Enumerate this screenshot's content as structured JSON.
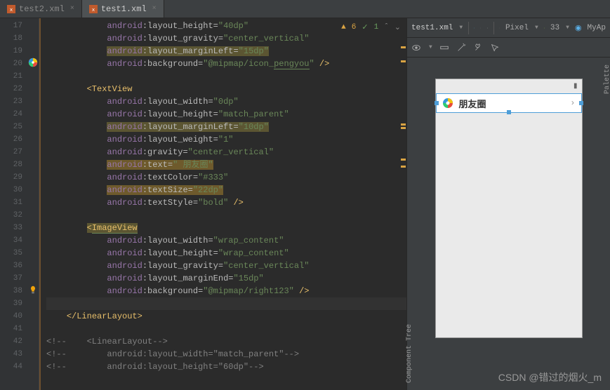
{
  "tabs": [
    {
      "name": "test2.xml",
      "active": false
    },
    {
      "name": "test1.xml",
      "active": true
    }
  ],
  "gutter": {
    "start": 17,
    "end": 44
  },
  "errors": {
    "warnings": "6",
    "oks": "1"
  },
  "code_lines": [
    {
      "n": 17,
      "indent": 3,
      "tokens": [
        [
          "ns",
          "android"
        ],
        [
          "attr",
          ":layout_height="
        ],
        [
          "val",
          "\"40dp\""
        ]
      ]
    },
    {
      "n": 18,
      "indent": 3,
      "tokens": [
        [
          "ns",
          "android"
        ],
        [
          "attr",
          ":layout_gravity="
        ],
        [
          "val",
          "\"center_vertical\""
        ]
      ]
    },
    {
      "n": 19,
      "indent": 3,
      "hl": true,
      "tokens": [
        [
          "ns",
          "android"
        ],
        [
          "attr",
          ":layout_marginLeft="
        ],
        [
          "val",
          "\"15dp\""
        ]
      ]
    },
    {
      "n": 20,
      "indent": 3,
      "img": true,
      "tokens": [
        [
          "ns",
          "android"
        ],
        [
          "attr",
          ":background="
        ],
        [
          "val",
          "\"@mipmap/icon_"
        ],
        [
          "valU",
          "pengyou"
        ],
        [
          "val",
          "\""
        ],
        [
          "br",
          " />"
        ]
      ]
    },
    {
      "n": 21,
      "indent": 0,
      "tokens": []
    },
    {
      "n": 22,
      "indent": 2,
      "tokens": [
        [
          "tag",
          "<TextView"
        ]
      ]
    },
    {
      "n": 23,
      "indent": 3,
      "tokens": [
        [
          "ns",
          "android"
        ],
        [
          "attr",
          ":layout_width="
        ],
        [
          "val",
          "\"0dp\""
        ]
      ]
    },
    {
      "n": 24,
      "indent": 3,
      "tokens": [
        [
          "ns",
          "android"
        ],
        [
          "attr",
          ":layout_height="
        ],
        [
          "val",
          "\"match_parent\""
        ]
      ]
    },
    {
      "n": 25,
      "indent": 3,
      "hl": true,
      "tokens": [
        [
          "ns",
          "android"
        ],
        [
          "attr",
          ":layout_marginLeft="
        ],
        [
          "val",
          "\"10dp\""
        ]
      ]
    },
    {
      "n": 26,
      "indent": 3,
      "tokens": [
        [
          "ns",
          "android"
        ],
        [
          "attr",
          ":layout_weight="
        ],
        [
          "val",
          "\"1\""
        ]
      ]
    },
    {
      "n": 27,
      "indent": 3,
      "tokens": [
        [
          "ns",
          "android"
        ],
        [
          "attr",
          ":gravity="
        ],
        [
          "val",
          "\"center_vertical\""
        ]
      ]
    },
    {
      "n": 28,
      "indent": 3,
      "hl2": true,
      "tokens": [
        [
          "ns",
          "android"
        ],
        [
          "attr",
          ":text="
        ],
        [
          "val",
          "\" 朋友圈\""
        ]
      ]
    },
    {
      "n": 29,
      "indent": 3,
      "tokens": [
        [
          "ns",
          "android"
        ],
        [
          "attr",
          ":textColor="
        ],
        [
          "val",
          "\"#333\""
        ]
      ]
    },
    {
      "n": 30,
      "indent": 3,
      "hl2": true,
      "tokens": [
        [
          "ns",
          "android"
        ],
        [
          "attr",
          ":textSize="
        ],
        [
          "val",
          "\"22dp\""
        ]
      ]
    },
    {
      "n": 31,
      "indent": 3,
      "tokens": [
        [
          "ns",
          "android"
        ],
        [
          "attr",
          ":textStyle="
        ],
        [
          "val",
          "\"bold\""
        ],
        [
          "br",
          " />"
        ]
      ]
    },
    {
      "n": 32,
      "indent": 0,
      "tokens": []
    },
    {
      "n": 33,
      "indent": 2,
      "hl": true,
      "tokens": [
        [
          "tag",
          "<"
        ],
        [
          "tagU",
          "ImageView"
        ]
      ]
    },
    {
      "n": 34,
      "indent": 3,
      "tokens": [
        [
          "ns",
          "android"
        ],
        [
          "attr",
          ":layout_width="
        ],
        [
          "val",
          "\"wrap_content\""
        ]
      ]
    },
    {
      "n": 35,
      "indent": 3,
      "tokens": [
        [
          "ns",
          "android"
        ],
        [
          "attr",
          ":layout_height="
        ],
        [
          "val",
          "\"wrap_content\""
        ]
      ]
    },
    {
      "n": 36,
      "indent": 3,
      "tokens": [
        [
          "ns",
          "android"
        ],
        [
          "attr",
          ":layout_gravity="
        ],
        [
          "val",
          "\"center_vertical\""
        ]
      ]
    },
    {
      "n": 37,
      "indent": 3,
      "tokens": [
        [
          "ns",
          "android"
        ],
        [
          "attr",
          ":layout_marginEnd="
        ],
        [
          "val",
          "\"15dp\""
        ]
      ]
    },
    {
      "n": 38,
      "indent": 3,
      "bulb": true,
      "tokens": [
        [
          "ns",
          "android"
        ],
        [
          "attr",
          ":background="
        ],
        [
          "val",
          "\"@mipmap/right123\""
        ],
        [
          "br",
          " />"
        ]
      ]
    },
    {
      "n": 39,
      "indent": 0,
      "caret": true,
      "tokens": []
    },
    {
      "n": 40,
      "indent": 1,
      "tokens": [
        [
          "tag",
          "</LinearLayout>"
        ]
      ]
    },
    {
      "n": 41,
      "indent": 0,
      "tokens": []
    },
    {
      "n": 42,
      "indent": 0,
      "tokens": [
        [
          "cmt",
          "<!--    <LinearLayout-->"
        ]
      ]
    },
    {
      "n": 43,
      "indent": 0,
      "tokens": [
        [
          "cmt",
          "<!--        android:layout_width=\"match_parent\"-->"
        ]
      ]
    },
    {
      "n": 44,
      "indent": 0,
      "tokens": [
        [
          "cmt",
          "<!--        android:layout_height=\"60dp\"-->"
        ]
      ]
    }
  ],
  "preview": {
    "file": "test1.xml",
    "device": "Pixel",
    "api": "33",
    "app": "MyAp",
    "row_text": "朋友圈"
  },
  "side_labels": {
    "palette": "Palette",
    "tree": "Component Tree"
  },
  "watermark": "CSDN @错过的烟火_m"
}
